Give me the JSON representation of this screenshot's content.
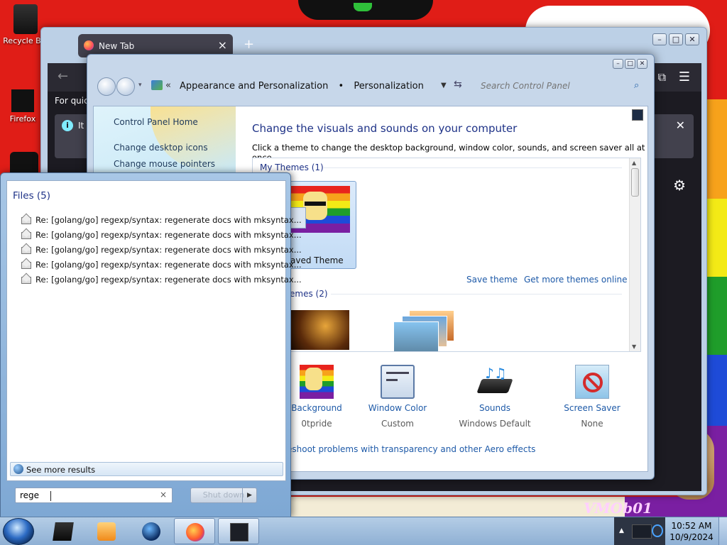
{
  "desktop": {
    "icons": [
      {
        "label": "Recycle Bin"
      },
      {
        "label": "Firefox"
      }
    ],
    "wallpaper_text": "VMOb01",
    "stripe_colors": [
      "#e01d17",
      "#f7a21b",
      "#f3ea16",
      "#1f9d2a",
      "#1e4bd8",
      "#7a1fa2"
    ]
  },
  "firefox": {
    "tab_title": "New Tab",
    "new_tab_symbol": "+",
    "quick_text": "For quick",
    "info_text": "It"
  },
  "control_panel": {
    "breadcrumb": [
      "Appearance and Personalization",
      "Personalization"
    ],
    "breadcrumb_sep": "•",
    "search_placeholder": "Search Control Panel",
    "sidebar": [
      {
        "label": "Control Panel Home"
      },
      {
        "label": "Change desktop icons"
      },
      {
        "label": "Change mouse pointers"
      }
    ],
    "title": "Change the visuals and sounds on your computer",
    "description": "Click a theme to change the desktop background, window color, sounds, and screen saver all at once.",
    "my_themes_header": "My Themes (1)",
    "saved_theme_label": "aved Theme",
    "save_theme_link": "Save theme",
    "more_themes_link": "Get more themes online",
    "installed_header": "emes (2)",
    "tools": [
      {
        "name": "Background",
        "sub": "0tpride"
      },
      {
        "name": "Window Color",
        "sub": "Custom"
      },
      {
        "name": "Sounds",
        "sub": "Windows Default"
      },
      {
        "name": "Screen Saver",
        "sub": "None"
      }
    ],
    "troubleshoot_link": "eshoot problems with transparency and other Aero effects"
  },
  "start_menu": {
    "files_header": "Files (5)",
    "files": [
      "Re: [golang/go] regexp/syntax: regenerate docs with mksyntax...",
      "Re: [golang/go] regexp/syntax: regenerate docs with mksyntax...",
      "Re: [golang/go] regexp/syntax: regenerate docs with mksyntax...",
      "Re: [golang/go] regexp/syntax: regenerate docs with mksyntax...",
      "Re: [golang/go] regexp/syntax: regenerate docs with mksyntax..."
    ],
    "see_more": "See more results",
    "search_value": "rege",
    "clear_symbol": "×",
    "shutdown_label": "Shut down"
  },
  "taskbar": {
    "time": "10:52 AM",
    "date": "10/9/2024"
  }
}
